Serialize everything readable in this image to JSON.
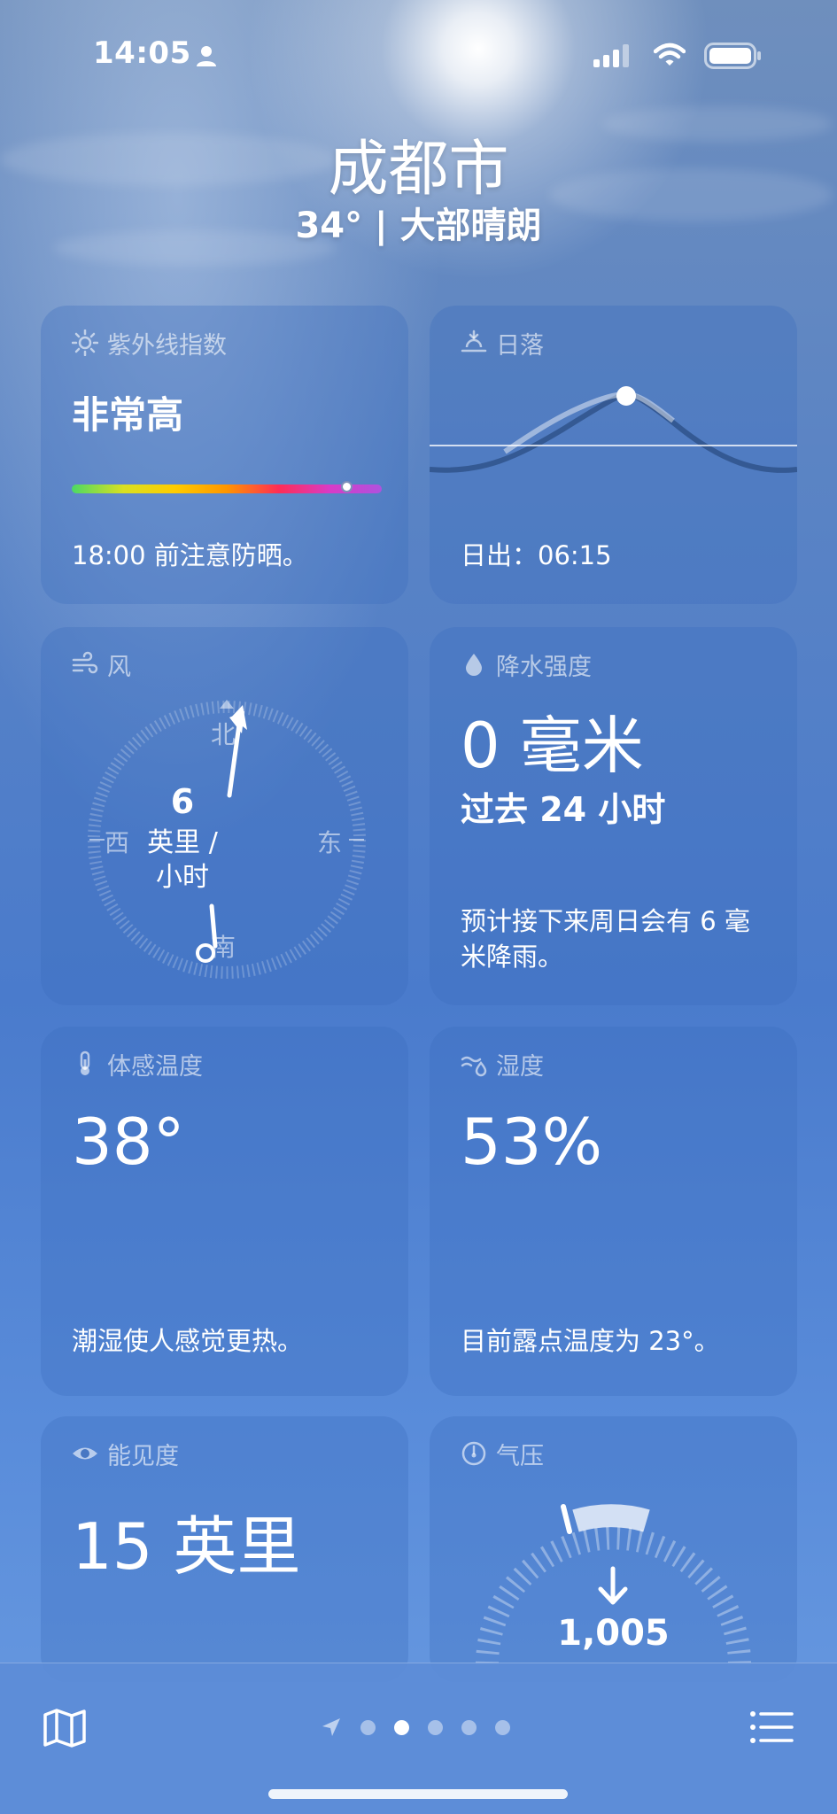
{
  "status": {
    "time": "14:05"
  },
  "header": {
    "city": "成都市",
    "summary": "34° | 大部晴朗"
  },
  "cards": {
    "uv": {
      "title": "紫外线指数",
      "level": "非常高",
      "note": "18:00 前注意防晒。"
    },
    "sunset": {
      "title": "日落",
      "note": "日出：06:15"
    },
    "wind": {
      "title": "风",
      "speed": "6",
      "unit_line1": "英里 /",
      "unit_line2": "小时",
      "north": "北",
      "south": "南",
      "east": "东",
      "west": "西"
    },
    "precip": {
      "title": "降水强度",
      "amount": "0 毫米",
      "period": "过去 24 小时",
      "note": "预计接下来周日会有 6 毫米降雨。"
    },
    "feels": {
      "title": "体感温度",
      "value": "38°",
      "note": "潮湿使人感觉更热。"
    },
    "humidity": {
      "title": "湿度",
      "value": "53%",
      "note": "目前露点温度为 23°。"
    },
    "visibility": {
      "title": "能见度",
      "value": "15 英里"
    },
    "pressure": {
      "title": "气压",
      "value": "1,005"
    }
  },
  "pager": {
    "page_count": 5,
    "active_index": 1
  },
  "colors": {
    "uv_gradient": [
      "#4cd964",
      "#ffcc00",
      "#ff9500",
      "#ff2d55",
      "#af52de"
    ]
  }
}
